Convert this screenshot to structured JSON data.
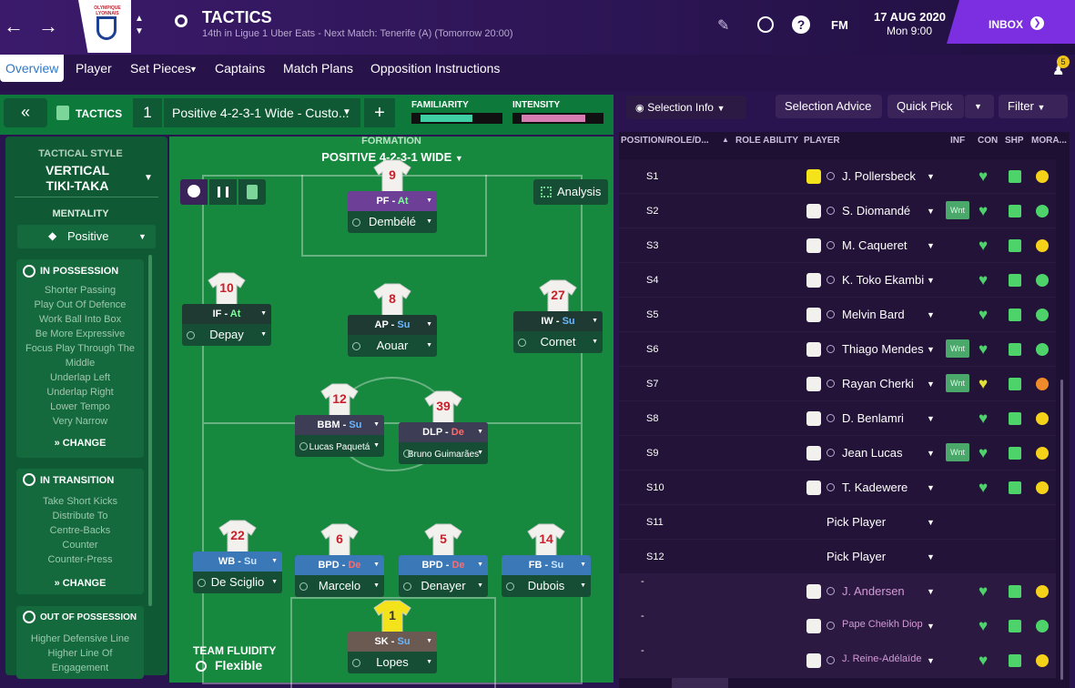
{
  "header": {
    "title": "TACTICS",
    "subtitle": "14th in Ligue 1 Uber Eats - Next Match: Tenerife (A) (Tomorrow 20:00)",
    "date": "17 AUG 2020",
    "time": "Mon 9:00",
    "fm": "FM",
    "inbox": "INBOX",
    "notif_count": "5",
    "club_logo_text": "OLYMPIQUE LYONNAIS"
  },
  "nav": {
    "tabs": [
      "Overview",
      "Player",
      "Set Pieces",
      "Captains",
      "Match Plans",
      "Opposition Instructions"
    ]
  },
  "tacbar": {
    "tactics_label": "TACTICS",
    "slot": "1",
    "tactic_name": "Positive 4-2-3-1 Wide - Custo...",
    "add": "+",
    "familiarity_label": "FAMILIARITY",
    "intensity_label": "INTENSITY",
    "familiarity_pct": 0.65,
    "intensity_pct": 0.8
  },
  "left": {
    "style_label": "TACTICAL STYLE",
    "style_line1": "VERTICAL",
    "style_line2": "TIKI-TAKA",
    "mentality_label": "MENTALITY",
    "mentality": "Positive",
    "in_possession": {
      "title": "IN POSSESSION",
      "items": [
        "Shorter Passing",
        "Play Out Of Defence",
        "Work Ball Into Box",
        "Be More Expressive",
        "Focus Play Through The",
        "Middle",
        "Underlap Left",
        "Underlap Right",
        "Lower Tempo",
        "Very Narrow"
      ],
      "change": "CHANGE"
    },
    "in_transition": {
      "title": "IN TRANSITION",
      "items": [
        "Take Short Kicks",
        "Distribute To",
        "Centre-Backs",
        "Counter",
        "Counter-Press"
      ],
      "change": "CHANGE"
    },
    "out_of_possession": {
      "title": "OUT OF POSSESSION",
      "items": [
        "Higher Defensive Line",
        "Higher Line Of",
        "Engagement"
      ]
    }
  },
  "pitch": {
    "formation_label": "FORMATION",
    "formation": "POSITIVE 4-2-3-1 WIDE",
    "analysis": "Analysis",
    "fluidity_label": "TEAM FLUIDITY",
    "fluidity": "Flexible",
    "players": [
      {
        "num": "9",
        "role": "PF",
        "duty": "At",
        "name": "Dembélé",
        "rolecolor": "#6e3f96",
        "dutycolor": "#7dff9a"
      },
      {
        "num": "10",
        "role": "IF",
        "duty": "At",
        "name": "Depay",
        "rolecolor": "#1f3a33",
        "dutycolor": "#7dff9a"
      },
      {
        "num": "8",
        "role": "AP",
        "duty": "Su",
        "name": "Aouar",
        "rolecolor": "#1f3a33",
        "dutycolor": "#6ab7ff"
      },
      {
        "num": "27",
        "role": "IW",
        "duty": "Su",
        "name": "Cornet",
        "rolecolor": "#1f3a33",
        "dutycolor": "#6ab7ff"
      },
      {
        "num": "12",
        "role": "BBM",
        "duty": "Su",
        "name": "Lucas Paquetá",
        "rolecolor": "#3d3d55",
        "dutycolor": "#6ab7ff"
      },
      {
        "num": "39",
        "role": "DLP",
        "duty": "De",
        "name": "Bruno Guimarães",
        "rolecolor": "#3d3d55",
        "dutycolor": "#ff6b6b"
      },
      {
        "num": "22",
        "role": "WB",
        "duty": "Su",
        "name": "De Sciglio",
        "rolecolor": "#3b78b8",
        "dutycolor": "#c8e6ff"
      },
      {
        "num": "6",
        "role": "BPD",
        "duty": "De",
        "name": "Marcelo",
        "rolecolor": "#3b78b8",
        "dutycolor": "#ff6b6b"
      },
      {
        "num": "5",
        "role": "BPD",
        "duty": "De",
        "name": "Denayer",
        "rolecolor": "#3b78b8",
        "dutycolor": "#ff6b6b"
      },
      {
        "num": "14",
        "role": "FB",
        "duty": "Su",
        "name": "Dubois",
        "rolecolor": "#3b78b8",
        "dutycolor": "#c8e6ff"
      },
      {
        "num": "1",
        "role": "SK",
        "duty": "Su",
        "name": "Lopes",
        "rolecolor": "#6b5a52",
        "dutycolor": "#6ab7ff"
      }
    ]
  },
  "right": {
    "selection_info": "Selection Info",
    "selection_advice": "Selection Advice",
    "quick_pick": "Quick Pick",
    "filter": "Filter",
    "columns": [
      "POSITION/ROLE/D...",
      "ROLE ABILITY",
      "PLAYER",
      "INF",
      "CON",
      "SHP",
      "MORA..."
    ],
    "rows": [
      {
        "pos": "S1",
        "player": "J. Pollersbeck",
        "inf": "",
        "morale": "yellow"
      },
      {
        "pos": "S2",
        "player": "S. Diomandé",
        "inf": "Wnt",
        "morale": "green"
      },
      {
        "pos": "S3",
        "player": "M. Caqueret",
        "inf": "",
        "morale": "yellow"
      },
      {
        "pos": "S4",
        "player": "K. Toko Ekambi",
        "inf": "",
        "morale": "green"
      },
      {
        "pos": "S5",
        "player": "Melvin Bard",
        "inf": "",
        "morale": "green"
      },
      {
        "pos": "S6",
        "player": "Thiago Mendes",
        "inf": "Wnt",
        "morale": "green"
      },
      {
        "pos": "S7",
        "player": "Rayan Cherki",
        "inf": "Wnt",
        "morale": "orange"
      },
      {
        "pos": "S8",
        "player": "D. Benlamri",
        "inf": "",
        "morale": "yellow"
      },
      {
        "pos": "S9",
        "player": "Jean Lucas",
        "inf": "Wnt",
        "morale": "yellow"
      },
      {
        "pos": "S10",
        "player": "T. Kadewere",
        "inf": "",
        "morale": "yellow"
      },
      {
        "pos": "S11",
        "player": "Pick Player",
        "inf": "",
        "morale": ""
      },
      {
        "pos": "S12",
        "player": "Pick Player",
        "inf": "",
        "morale": ""
      },
      {
        "pos": "-",
        "player": "J. Andersen",
        "inf": "",
        "morale": "yellow"
      },
      {
        "pos": "-",
        "player": "Pape Cheikh Diop",
        "inf": "",
        "morale": "green"
      },
      {
        "pos": "-",
        "player": "J. Reine-Adélaïde",
        "inf": "",
        "morale": "yellow"
      }
    ]
  }
}
